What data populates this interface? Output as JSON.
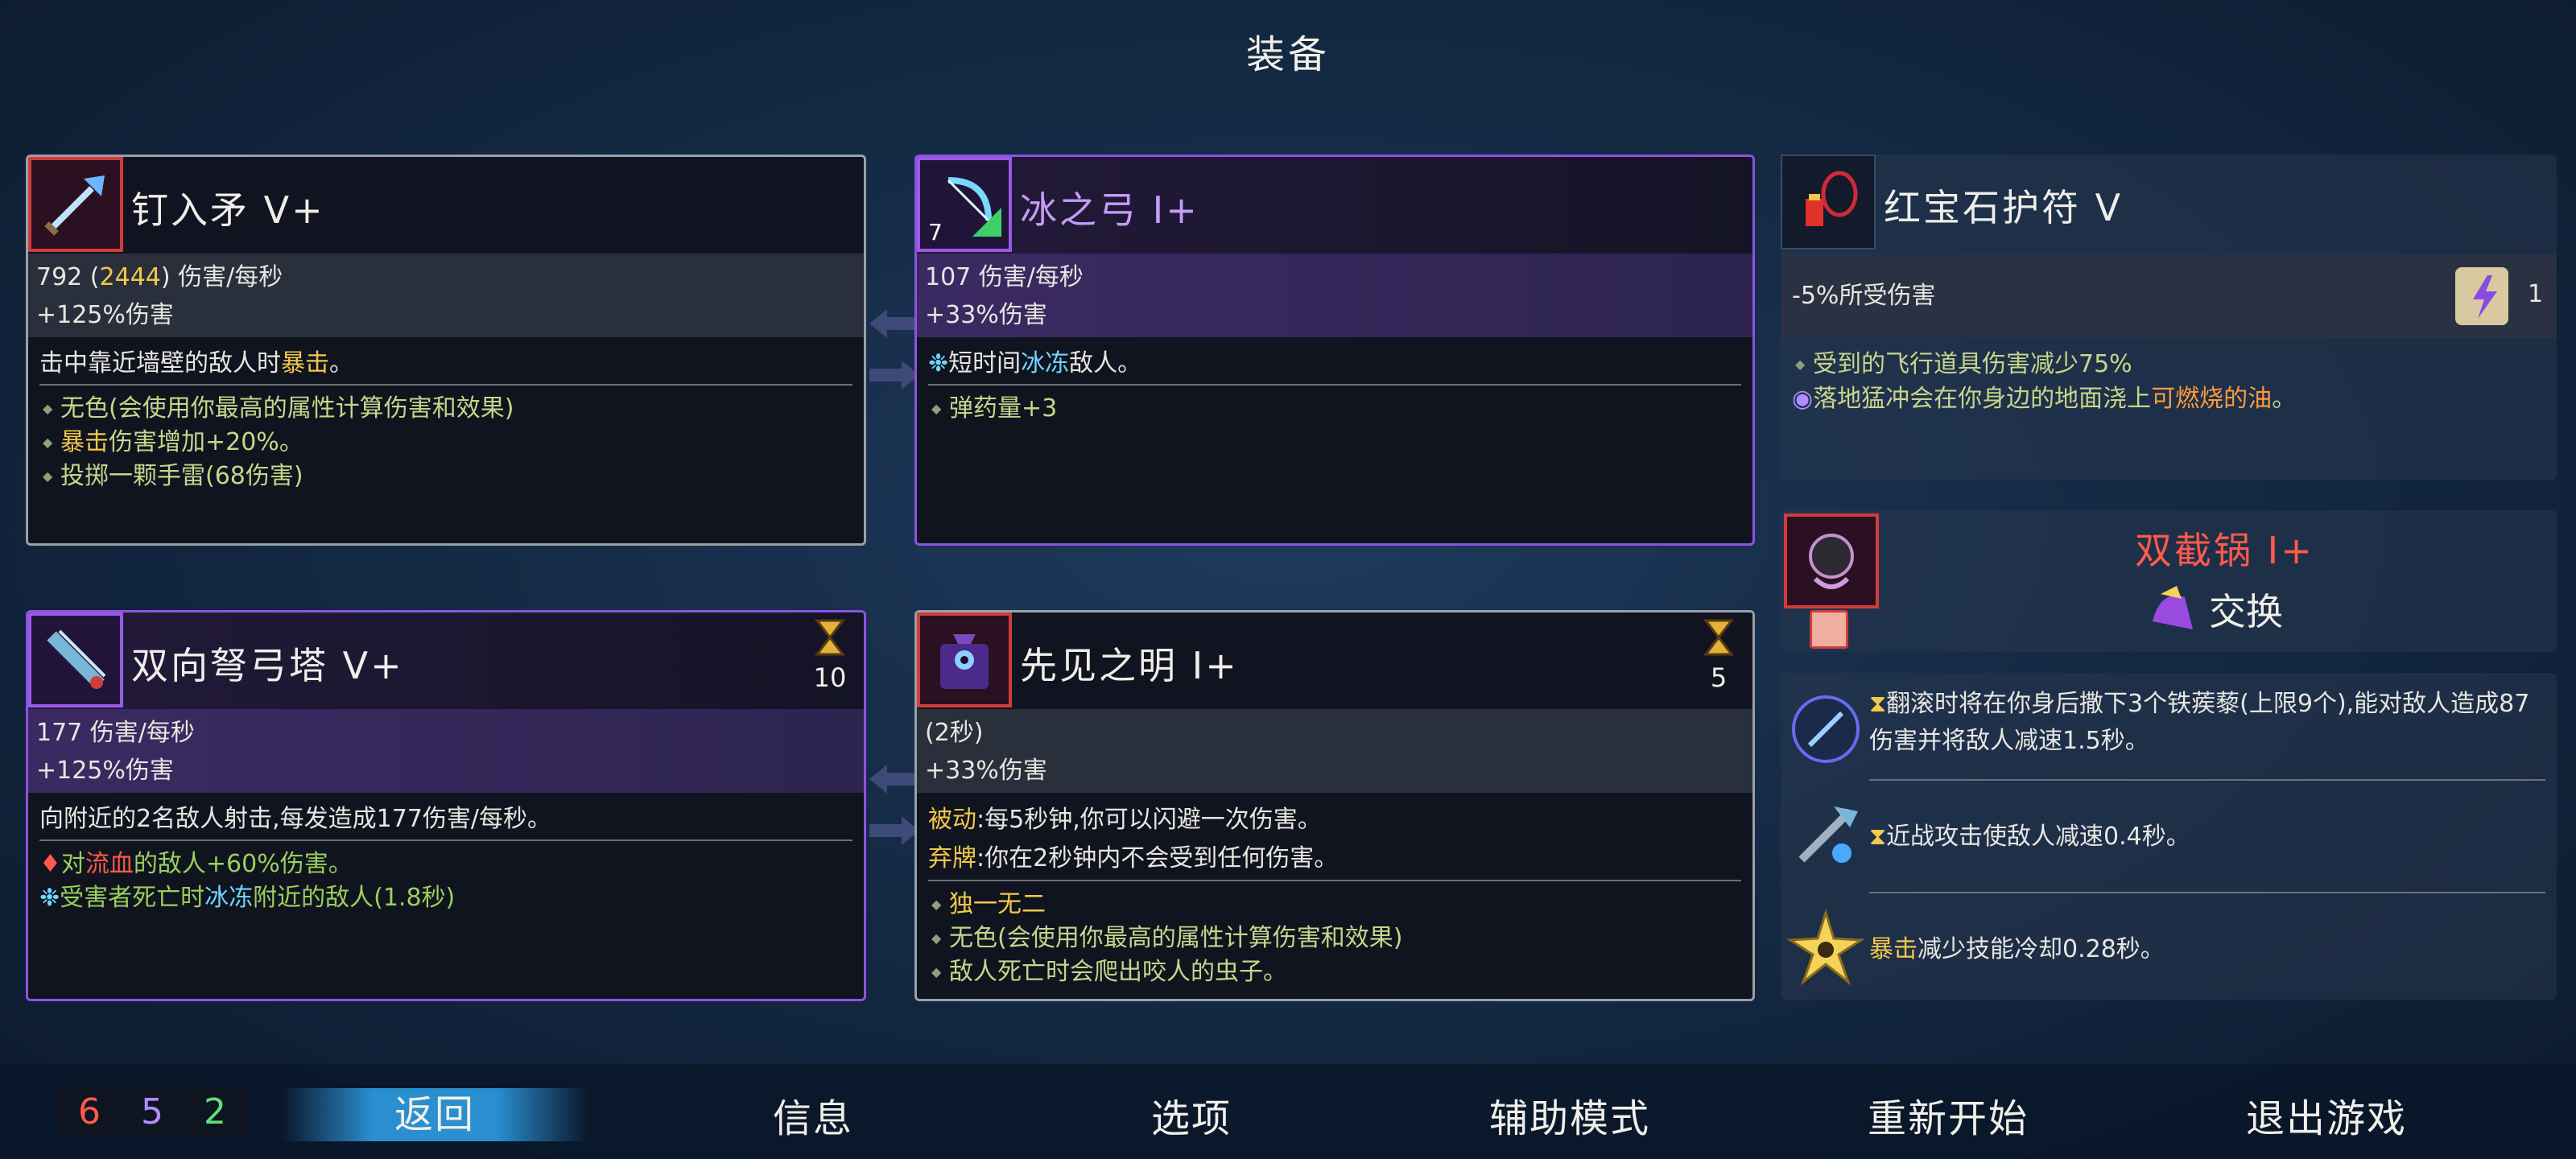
{
  "title": "装备",
  "weapons": [
    {
      "name": "钉入矛 V+",
      "icon": "spear-icon",
      "dps_base": "792",
      "dps_bonus": "2444",
      "dps_unit": "伤害/每秒",
      "bonus": "+125%伤害",
      "main_desc_prefix": "击中靠近墙壁的敌人时",
      "main_desc_keyword": "暴击",
      "main_desc_suffix": "。",
      "mods": [
        {
          "text": "无色(会使用你最高的属性计算伤害和效果)"
        },
        {
          "keyword": "暴击",
          "text": "伤害增加+20%。"
        },
        {
          "text": "投掷一颗手雷(68伤害)"
        }
      ]
    },
    {
      "name": "冰之弓 I+",
      "icon": "ice-bow-icon",
      "corner_value": "7",
      "dps": "107 伤害/每秒",
      "bonus": "+33%伤害",
      "main_desc_prefix": "短时间",
      "main_desc_keyword": "冰冻",
      "main_desc_suffix": "敌人。",
      "mods": [
        {
          "text": "弹药量+3"
        }
      ]
    }
  ],
  "skills": [
    {
      "name": "双向弩弓塔 V+",
      "icon": "crossbow-turret-icon",
      "cooldown": "10",
      "dps": "177 伤害/每秒",
      "bonus": "+125%伤害",
      "main_desc": "向附近的2名敌人射击,每发造成177伤害/每秒。",
      "mod1_prefix": "对",
      "mod1_keyword": "流血",
      "mod1_suffix": "的敌人+60%伤害。",
      "mod2_prefix": "受害者死亡时",
      "mod2_keyword": "冰冻",
      "mod2_suffix": "附近的敌人(1.8秒)"
    },
    {
      "name": "先见之明 I+",
      "icon": "foresight-icon",
      "cooldown": "5",
      "duration": "(2秒)",
      "bonus": "+33%伤害",
      "passive_label": "被动",
      "passive_text": ":每5秒钟,你可以闪避一次伤害。",
      "discard_label": "弃牌",
      "discard_text": ":你在2秒钟内不会受到任何伤害。",
      "mods": [
        {
          "text": "独一无二",
          "gold": true
        },
        {
          "text": "无色(会使用你最高的属性计算伤害和效果)"
        },
        {
          "text": "敌人死亡时会爬出咬人的虫子。"
        }
      ]
    }
  ],
  "amulet": {
    "name": "红宝石护符 V",
    "icon": "ruby-amulet-icon",
    "stat": "-5%所受伤害",
    "scroll_count": "1",
    "mod1": "受到的飞行道具伤害减少75%",
    "mod2_prefix": "落地猛冲会在你身边的地面浇上",
    "mod2_keyword": "可燃烧的油",
    "mod2_suffix": "。"
  },
  "mutation": {
    "name": "双截锅 I+",
    "swap_label": "交换"
  },
  "perks": [
    {
      "icon": "caltrops-icon",
      "text": "翻滚时将在你身后撒下3个铁蒺藜(上限9个),能对敌人造成87伤害并将敌人减速1.5秒。"
    },
    {
      "icon": "frost-blade-icon",
      "text": "近战攻击使敌人减速0.4秒。"
    },
    {
      "icon": "crit-burst-icon",
      "keyword": "暴击",
      "text": "减少技能冷却0.28秒。"
    }
  ],
  "scrolls": {
    "brutality": "6",
    "tactics": "5",
    "survival": "2"
  },
  "menu": [
    "返回",
    "信息",
    "选项",
    "辅助模式",
    "重新开始",
    "退出游戏"
  ],
  "colors": {
    "brutality": "#ff5a4a",
    "tactics": "#b48cff",
    "survival": "#5ee07a",
    "gold": "#f3c84b",
    "ice": "#6fd5ff"
  }
}
